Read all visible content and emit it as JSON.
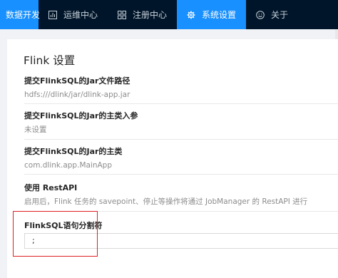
{
  "nav": {
    "items": [
      {
        "label": "数据开发",
        "icon": "none",
        "active": true
      },
      {
        "label": "运维中心",
        "icon": "dashboard-icon",
        "active": false
      },
      {
        "label": "注册中心",
        "icon": "grid-icon",
        "active": false
      },
      {
        "label": "系统设置",
        "icon": "gear-icon",
        "active": true
      },
      {
        "label": "关于",
        "icon": "smile-icon",
        "active": false
      }
    ]
  },
  "card": {
    "title": "Flink 设置",
    "settings": [
      {
        "label": "提交FlinkSQL的Jar文件路径",
        "value": "hdfs:///dlink/jar/dlink-app.jar"
      },
      {
        "label": "提交FlinkSQL的Jar的主类入参",
        "value": "未设置"
      },
      {
        "label": "提交FlinkSQL的Jar的主类",
        "value": "com.dlink.app.MainApp"
      },
      {
        "label": "使用 RestAPI",
        "value": "启用后，Flink 任务的 savepoint、停止等操作将通过 JobManager 的 RestAPI 进行"
      },
      {
        "label": "FlinkSQL语句分割符",
        "value": ";"
      }
    ]
  },
  "colors": {
    "nav_bg": "#001529",
    "accent": "#1890ff",
    "highlight": "#e02020"
  }
}
